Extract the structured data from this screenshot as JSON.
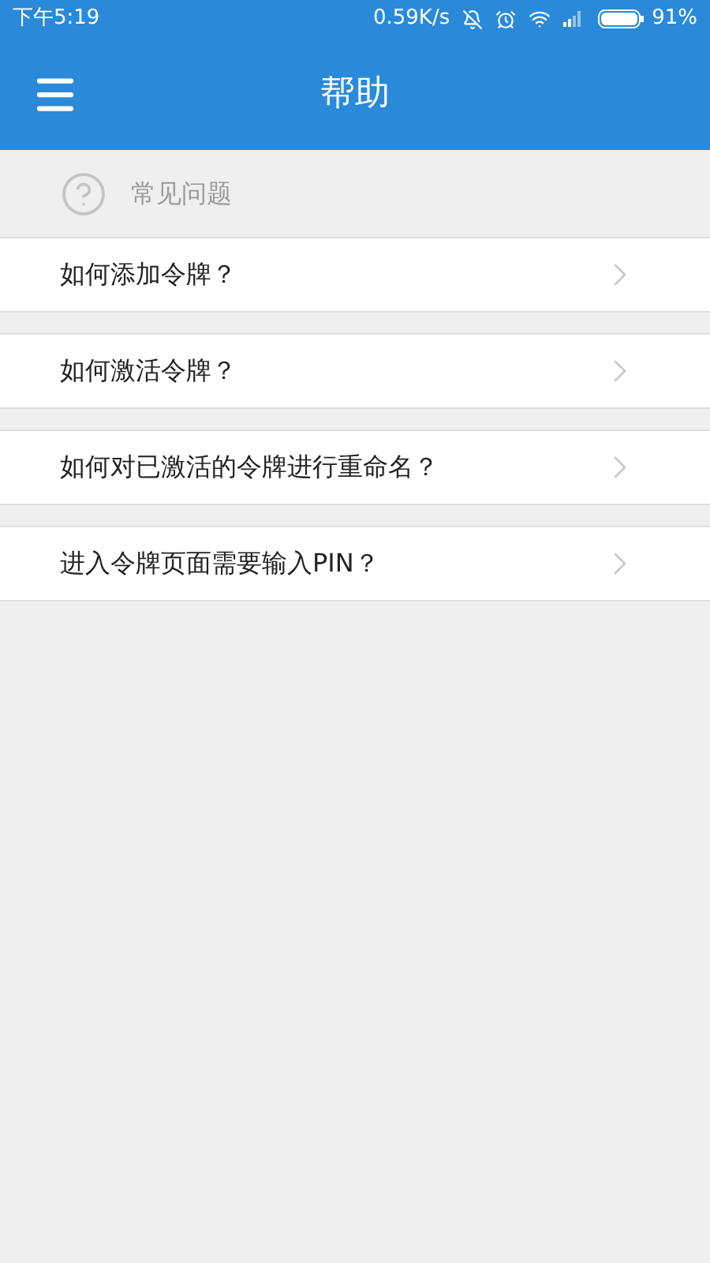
{
  "status_bar": {
    "time": "下午5:19",
    "speed": "0.59K/s",
    "battery": "91%"
  },
  "header": {
    "title": "帮助"
  },
  "section": {
    "title": "常见问题"
  },
  "faq_items": [
    {
      "label": "如何添加令牌？"
    },
    {
      "label": "如何激活令牌？"
    },
    {
      "label": "如何对已激活的令牌进行重命名？"
    },
    {
      "label": "进入令牌页面需要输入PIN？"
    }
  ]
}
